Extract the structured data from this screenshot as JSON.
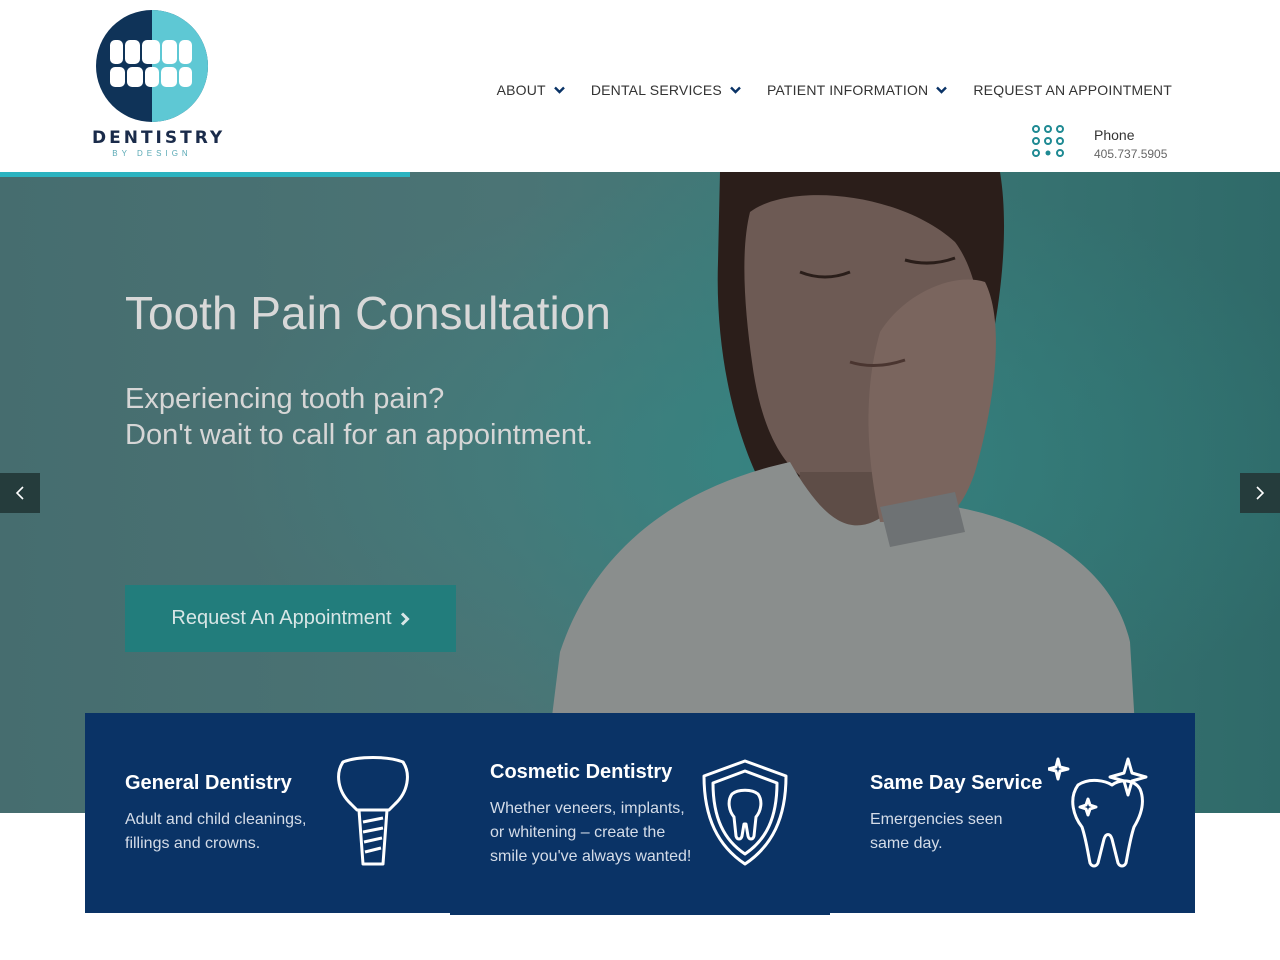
{
  "brand": {
    "name": "DENTISTRY",
    "tagline": "BY DESIGN",
    "colors": {
      "navy": "#0a3366",
      "teal": "#2bb3c0",
      "logo_dark": "#1a2b4a",
      "logo_light": "#5ec8d4"
    }
  },
  "nav": {
    "items": [
      {
        "label": "ABOUT",
        "has_dropdown": true
      },
      {
        "label": "DENTAL SERVICES",
        "has_dropdown": true
      },
      {
        "label": "PATIENT INFORMATION",
        "has_dropdown": true
      },
      {
        "label": "REQUEST AN APPOINTMENT",
        "has_dropdown": false
      }
    ]
  },
  "contact": {
    "phone_label": "Phone",
    "phone_number": "405.737.5905",
    "icon": "dialpad-icon"
  },
  "slider": {
    "progress": 0.32
  },
  "hero": {
    "title": "Tooth Pain Consultation",
    "subtitle_line1": "Experiencing tooth pain?",
    "subtitle_line2": "Don't wait to call for an appointment.",
    "cta_label": "Request An Appointment",
    "prev_icon": "chevron-left-icon",
    "next_icon": "chevron-right-icon"
  },
  "services": [
    {
      "title": "General Dentistry",
      "text": [
        "Adult and child cleanings,",
        "fillings and crowns."
      ],
      "icon": "tooth-implant-icon"
    },
    {
      "title": "Cosmetic Dentistry",
      "text": [
        "Whether veneers, implants,",
        "or whitening – create the",
        "smile you've always wanted!"
      ],
      "icon": "tooth-shield-icon"
    },
    {
      "title": "Same Day Service",
      "text": [
        "Emergencies seen",
        "same day."
      ],
      "icon": "sparkling-tooth-icon"
    }
  ]
}
